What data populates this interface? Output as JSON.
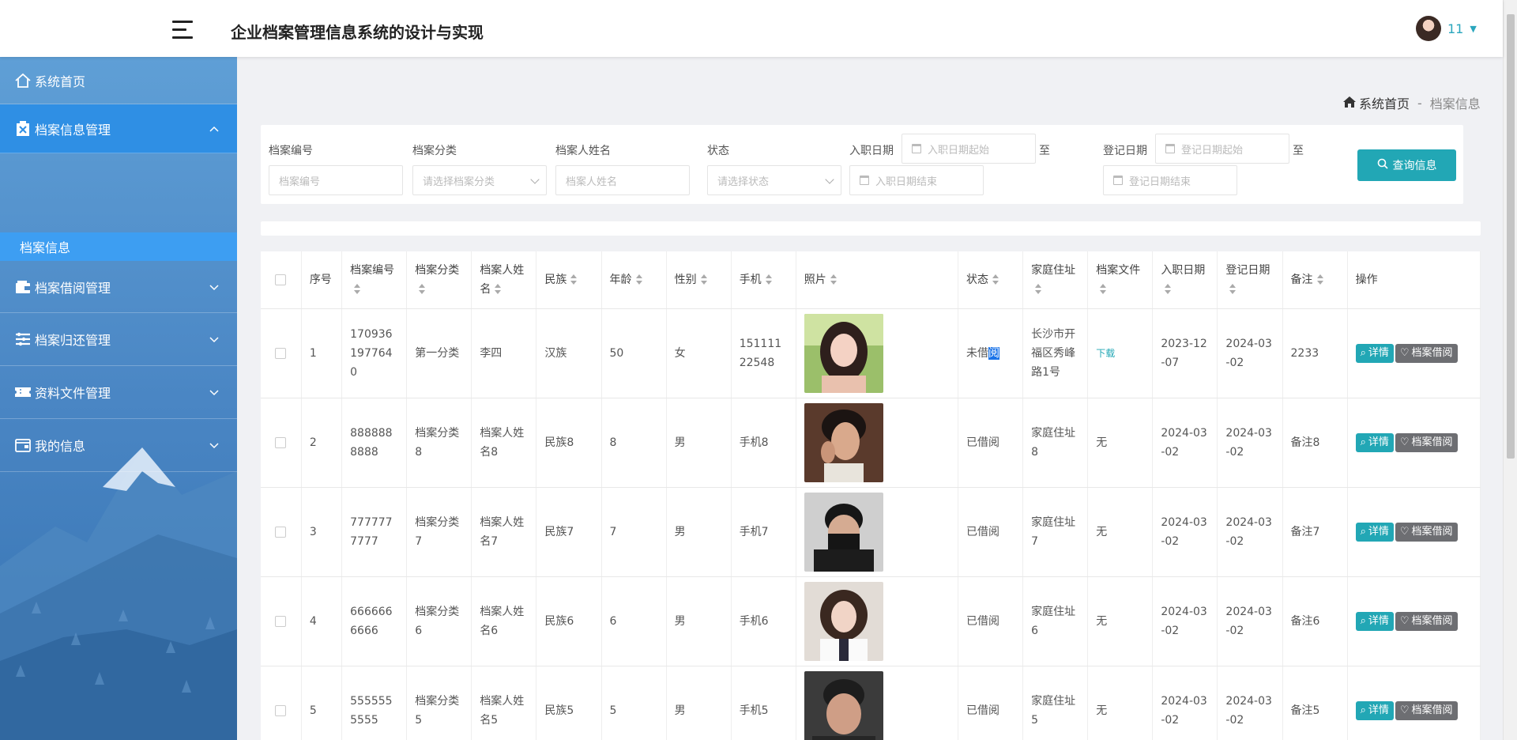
{
  "header": {
    "title": "企业档案管理信息系统的设计与实现",
    "username": "11"
  },
  "sidebar": {
    "items": [
      {
        "label": "系统首页"
      },
      {
        "label": "档案信息管理"
      },
      {
        "label": "档案借阅管理"
      },
      {
        "label": "档案归还管理"
      },
      {
        "label": "资料文件管理"
      },
      {
        "label": "我的信息"
      }
    ],
    "sub_item": "档案信息"
  },
  "breadcrumb": {
    "home": "系统首页",
    "separator": "-",
    "current": "档案信息"
  },
  "search": {
    "archive_no_label": "档案编号",
    "archive_no_placeholder": "档案编号",
    "category_label": "档案分类",
    "category_placeholder": "请选择档案分类",
    "name_label": "档案人姓名",
    "name_placeholder": "档案人姓名",
    "status_label": "状态",
    "status_placeholder": "请选择状态",
    "hire_label": "入职日期",
    "hire_start_placeholder": "入职日期起始",
    "hire_end_placeholder": "入职日期结束",
    "to": "至",
    "reg_label": "登记日期",
    "reg_start_placeholder": "登记日期起始",
    "reg_end_placeholder": "登记日期结束",
    "button_label": "查询信息"
  },
  "table": {
    "headers": [
      "序号",
      "档案编号",
      "档案分类",
      "档案人姓名",
      "民族",
      "年龄",
      "性别",
      "手机",
      "照片",
      "状态",
      "家庭住址",
      "档案文件",
      "入职日期",
      "登记日期",
      "备注",
      "操作"
    ],
    "detail_label": "详情",
    "borrow_label": "档案借阅",
    "rows": [
      {
        "index": "1",
        "archive_no": "1709361977640",
        "category": "第一分类",
        "name": "李四",
        "ethnicity": "汉族",
        "age": "50",
        "gender": "女",
        "phone": "15111122548",
        "status_pre": "未借",
        "status_sel": "阅",
        "address": "长沙市开福区秀峰路1号",
        "file": "下载",
        "hire_date": "2023-12-07",
        "reg_date": "2024-03-02",
        "remark": "2233"
      },
      {
        "index": "2",
        "archive_no": "8888888888",
        "category": "档案分类8",
        "name": "档案人姓名8",
        "ethnicity": "民族8",
        "age": "8",
        "gender": "男",
        "phone": "手机8",
        "status_pre": "已借阅",
        "status_sel": "",
        "address": "家庭住址8",
        "file": "无",
        "hire_date": "2024-03-02",
        "reg_date": "2024-03-02",
        "remark": "备注8"
      },
      {
        "index": "3",
        "archive_no": "7777777777",
        "category": "档案分类7",
        "name": "档案人姓名7",
        "ethnicity": "民族7",
        "age": "7",
        "gender": "男",
        "phone": "手机7",
        "status_pre": "已借阅",
        "status_sel": "",
        "address": "家庭住址7",
        "file": "无",
        "hire_date": "2024-03-02",
        "reg_date": "2024-03-02",
        "remark": "备注7"
      },
      {
        "index": "4",
        "archive_no": "6666666666",
        "category": "档案分类6",
        "name": "档案人姓名6",
        "ethnicity": "民族6",
        "age": "6",
        "gender": "男",
        "phone": "手机6",
        "status_pre": "已借阅",
        "status_sel": "",
        "address": "家庭住址6",
        "file": "无",
        "hire_date": "2024-03-02",
        "reg_date": "2024-03-02",
        "remark": "备注6"
      },
      {
        "index": "5",
        "archive_no": "5555555555",
        "category": "档案分类5",
        "name": "档案人姓名5",
        "ethnicity": "民族5",
        "age": "5",
        "gender": "男",
        "phone": "手机5",
        "status_pre": "已借阅",
        "status_sel": "",
        "address": "家庭住址5",
        "file": "无",
        "hire_date": "2024-03-02",
        "reg_date": "2024-03-02",
        "remark": "备注5"
      }
    ]
  },
  "colors": {
    "accent": "#22a7b5",
    "sidebar_active": "#2f8fe4",
    "sidebar_sub": "#3d9ef2",
    "borrow_button": "#6d6e72"
  }
}
